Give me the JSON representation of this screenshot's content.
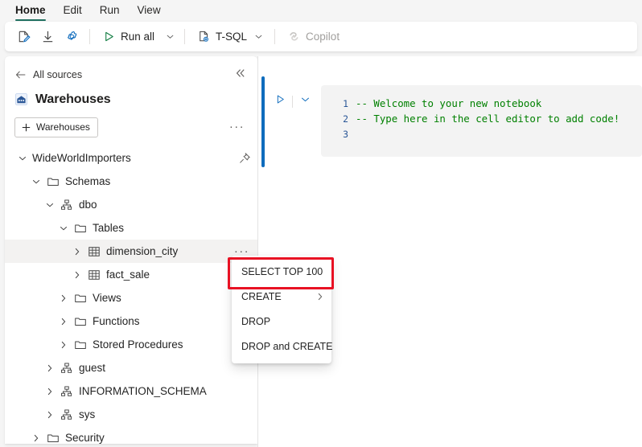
{
  "window": {
    "tabs": [
      {
        "label": "Home",
        "active": true
      },
      {
        "label": "Edit",
        "active": false
      },
      {
        "label": "Run",
        "active": false
      },
      {
        "label": "View",
        "active": false
      }
    ],
    "active_tab_underline_color": "#1f6e5e"
  },
  "ribbon": {
    "items": [
      {
        "name": "edit-notebook-button",
        "icon": "edit-document-icon",
        "label": "",
        "disabled": false
      },
      {
        "name": "download-button",
        "icon": "download-icon",
        "label": "",
        "disabled": false
      },
      {
        "name": "settings-button",
        "icon": "gear-icon",
        "label": "",
        "disabled": false
      },
      {
        "name": "run-all-button",
        "icon": "play-triangle-icon",
        "label": "Run all",
        "disabled": false
      },
      {
        "name": "t-sql-language-button",
        "icon": "sql-document-icon",
        "label": "T-SQL",
        "disabled": false
      },
      {
        "name": "copilot-button",
        "icon": "copilot-icon",
        "label": "Copilot",
        "disabled": true
      }
    ],
    "run_all_label": "Run all",
    "tsql_label": "T-SQL",
    "copilot_label": "Copilot"
  },
  "sidebar": {
    "back_label": "All sources",
    "collapse_icon": "chevron-double-left-icon",
    "title": "Warehouses",
    "title_icon": "warehouse-icon",
    "new_button_label": "Warehouses",
    "more_label": "···",
    "tree": [
      {
        "label": "WideWorldImporters",
        "icon": "database-icon",
        "chevron": "expanded",
        "indent": 0,
        "pinned": true,
        "selected": false,
        "show_icon": false
      },
      {
        "label": "Schemas",
        "icon": "folder-icon",
        "chevron": "expanded",
        "indent": 1,
        "selected": false,
        "show_icon": true
      },
      {
        "label": "dbo",
        "icon": "schema-icon",
        "chevron": "expanded",
        "indent": 2,
        "selected": false,
        "show_icon": true
      },
      {
        "label": "Tables",
        "icon": "folder-icon",
        "chevron": "expanded",
        "indent": 3,
        "selected": false,
        "show_icon": true
      },
      {
        "label": "dimension_city",
        "icon": "table-icon",
        "chevron": "collapsed",
        "indent": 4,
        "selected": true,
        "show_icon": true,
        "more": true
      },
      {
        "label": "fact_sale",
        "icon": "table-icon",
        "chevron": "collapsed",
        "indent": 4,
        "selected": false,
        "show_icon": true
      },
      {
        "label": "Views",
        "icon": "folder-icon",
        "chevron": "collapsed",
        "indent": 3,
        "selected": false,
        "show_icon": true
      },
      {
        "label": "Functions",
        "icon": "folder-icon",
        "chevron": "collapsed",
        "indent": 3,
        "selected": false,
        "show_icon": true
      },
      {
        "label": "Stored Procedures",
        "icon": "folder-icon",
        "chevron": "collapsed",
        "indent": 3,
        "selected": false,
        "show_icon": true
      },
      {
        "label": "guest",
        "icon": "schema-icon",
        "chevron": "collapsed",
        "indent": 2,
        "selected": false,
        "show_icon": true
      },
      {
        "label": "INFORMATION_SCHEMA",
        "icon": "schema-icon",
        "chevron": "collapsed",
        "indent": 2,
        "selected": false,
        "show_icon": true
      },
      {
        "label": "sys",
        "icon": "schema-icon",
        "chevron": "collapsed",
        "indent": 2,
        "selected": false,
        "show_icon": true
      },
      {
        "label": "Security",
        "icon": "folder-icon",
        "chevron": "collapsed",
        "indent": 1,
        "selected": false,
        "show_icon": true
      }
    ]
  },
  "notebook": {
    "cell_accent_color": "#0f6cbd",
    "run_cell_icon": "play-triangle-icon",
    "cell_menu_icon": "chevron-down-icon",
    "code_lines": [
      {
        "num": "1",
        "text": "-- Welcome to your new notebook"
      },
      {
        "num": "2",
        "text": "-- Type here in the cell editor to add code!"
      },
      {
        "num": "3",
        "text": ""
      }
    ],
    "code_color": "#008000",
    "line_number_color": "#2b5797"
  },
  "context_menu": {
    "items": [
      {
        "label": "SELECT TOP 100",
        "submenu": false,
        "highlighted": true
      },
      {
        "label": "CREATE",
        "submenu": true,
        "highlighted": false
      },
      {
        "label": "DROP",
        "submenu": false,
        "highlighted": false
      },
      {
        "label": "DROP and CREATE",
        "submenu": false,
        "highlighted": false
      }
    ],
    "highlight_color": "#e81123"
  }
}
